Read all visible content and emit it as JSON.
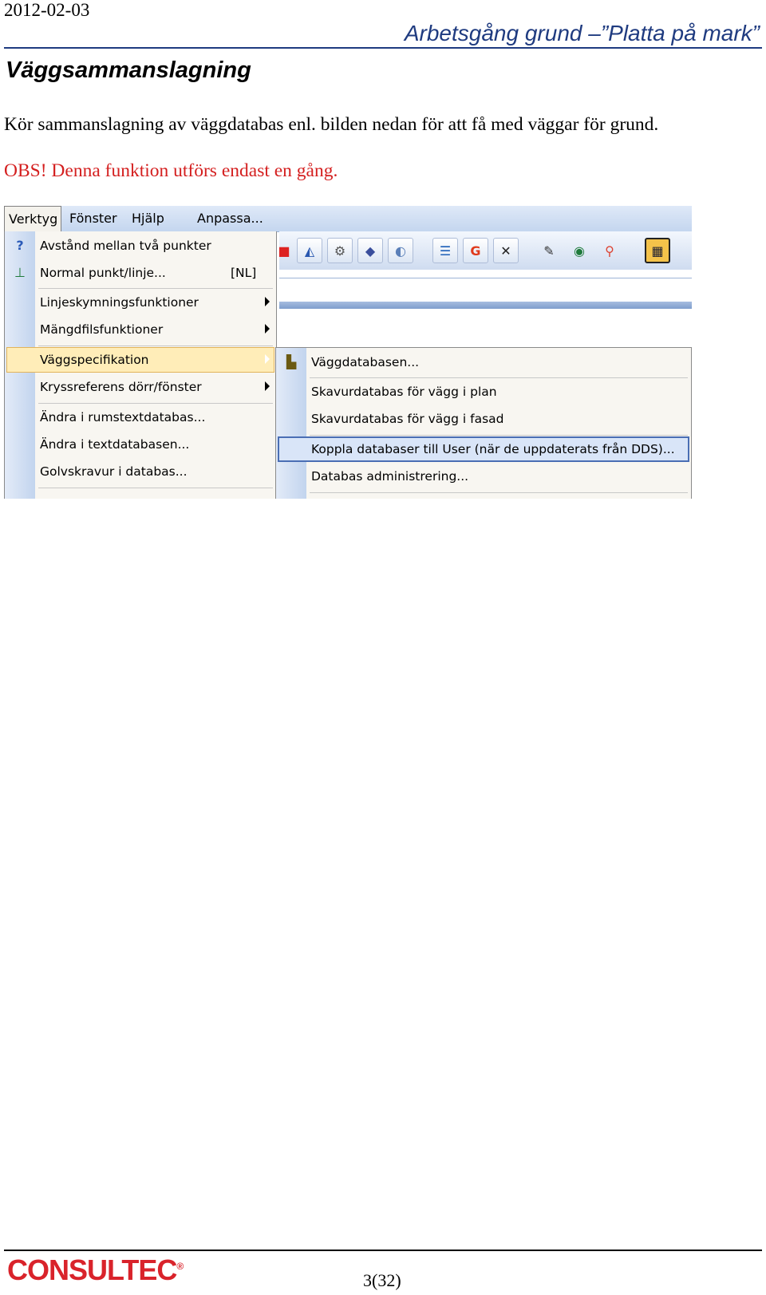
{
  "header": {
    "date": "2012-02-03",
    "title": "Arbetsgång grund –”Platta på mark”"
  },
  "section": {
    "heading": "Väggsammanslagning",
    "body": "Kör sammanslagning av väggdatabas enl. bilden nedan för att få med väggar för grund.",
    "obs": "OBS! Denna funktion utförs endast en gång."
  },
  "screenshot": {
    "menubar": [
      "Verktyg",
      "Fönster",
      "Hjälp",
      "Anpassa..."
    ],
    "menu": [
      {
        "label": "Avstånd mellan två punkter",
        "shortcut": "",
        "icon": "ruler-question-icon"
      },
      {
        "label": "Normal punkt/linje...",
        "shortcut": "[NL]",
        "icon": "normal-line-icon"
      },
      {
        "label": "Linjeskymningsfunktioner",
        "shortcut": "",
        "submenu": true
      },
      {
        "label": "Mängdfilsfunktioner",
        "shortcut": "",
        "submenu": true
      },
      {
        "label": "Väggspecifikation",
        "shortcut": "",
        "submenu": true,
        "highlighted": true
      },
      {
        "label": "Kryssreferens dörr/fönster",
        "shortcut": "",
        "submenu": true
      },
      {
        "label": "Ändra i rumstextdatabas...",
        "shortcut": ""
      },
      {
        "label": "Ändra i textdatabasen...",
        "shortcut": ""
      },
      {
        "label": "Golvskravur i databas...",
        "shortcut": ""
      }
    ],
    "submenu": [
      {
        "label": "Väggdatabasen...",
        "icon": "wall-database-icon"
      },
      {
        "label": "Skavurdatabas för vägg i plan"
      },
      {
        "label": "Skavurdatabas för vägg i fasad"
      },
      {
        "label": "Koppla databaser till User (när de uppdaterats från DDS)...",
        "highlighted": true
      },
      {
        "label": "Databas administrering..."
      }
    ],
    "toolbar_glyphs": [
      "G"
    ]
  },
  "footer": {
    "logo": "CONSULTEC",
    "registered": "®",
    "page": "3(32)"
  }
}
